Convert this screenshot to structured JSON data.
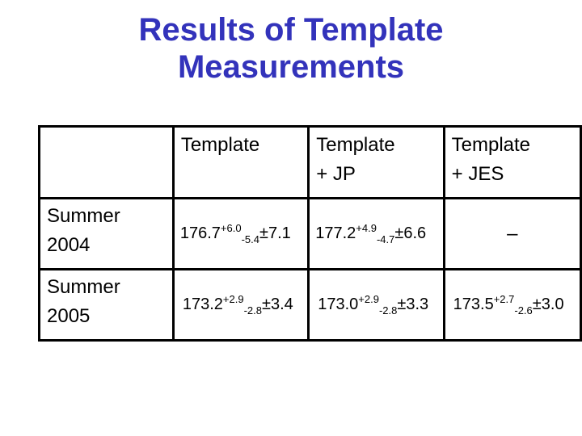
{
  "title": {
    "line1": "Results of Template",
    "line2": "Measurements"
  },
  "table": {
    "headers": [
      {
        "line1": "",
        "line2": ""
      },
      {
        "line1": "Template",
        "line2": ""
      },
      {
        "line1": "Template",
        "line2": "+ JP"
      },
      {
        "line1": "Template",
        "line2": "+ JES"
      }
    ],
    "rows": [
      {
        "label_line1": "Summer",
        "label_line2": "2004",
        "cells": [
          {
            "central": "176.7",
            "plus": "+6.0",
            "minus": "-5.4",
            "pm": "±7.1"
          },
          {
            "central": "177.2",
            "plus": "+4.9",
            "minus": "-4.7",
            "pm": "±6.6"
          },
          {
            "dash": "–"
          }
        ]
      },
      {
        "label_line1": "Summer",
        "label_line2": "2005",
        "cells": [
          {
            "central": "173.2",
            "plus": "+2.9",
            "minus": "-2.8",
            "pm": "±3.4"
          },
          {
            "central": "173.0",
            "plus": "+2.9",
            "minus": "-2.8",
            "pm": "±3.3"
          },
          {
            "central": "173.5",
            "plus": "+2.7",
            "minus": "-2.6",
            "pm": "±3.0"
          }
        ]
      }
    ]
  },
  "colors": {
    "title": "#3333bb",
    "border": "#000000"
  }
}
